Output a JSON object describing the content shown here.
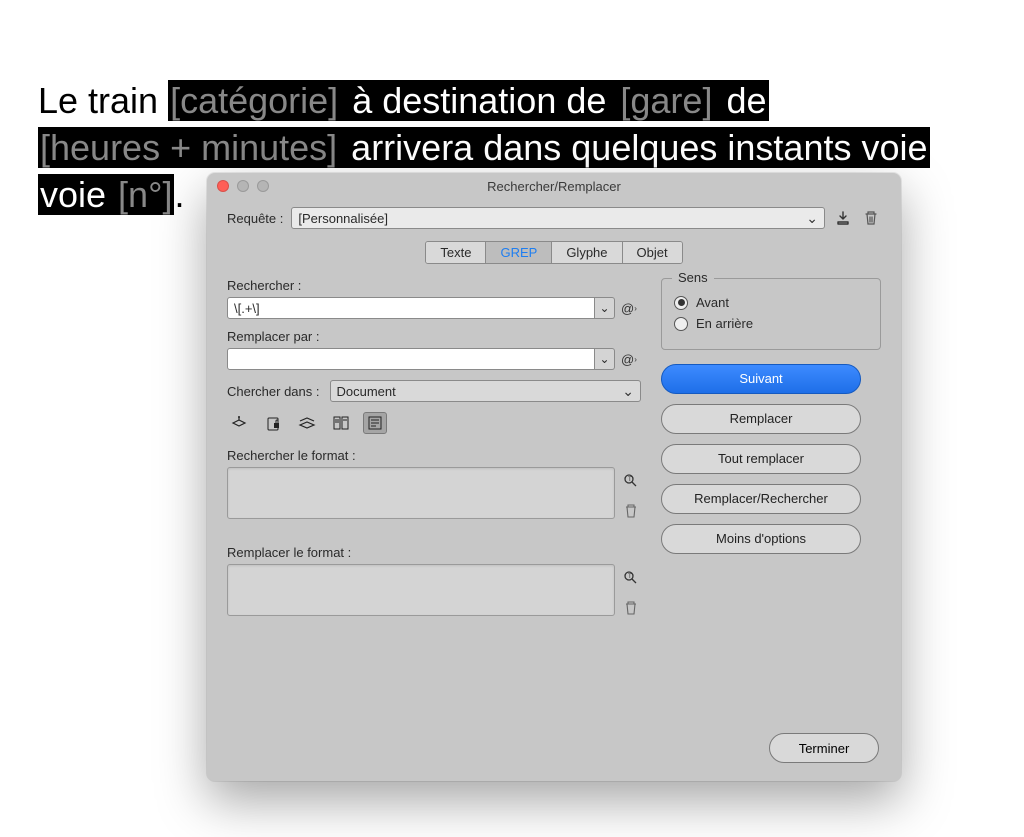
{
  "sentence": {
    "p1": "Le train ",
    "ph1": "[catégorie]",
    "p2": " à destination de ",
    "ph2": "[gare]",
    "p3": " de ",
    "ph3": "[heures + minutes]",
    "p4": " arrivera dans quelques instants voie ",
    "ph4": "[n°]",
    "p5": "."
  },
  "dialog": {
    "title": "Rechercher/Remplacer",
    "query_label": "Requête :",
    "query_value": "[Personnalisée]",
    "tabs": {
      "text": "Texte",
      "grep": "GREP",
      "glyph": "Glyphe",
      "object": "Objet"
    },
    "find_label": "Rechercher :",
    "find_value": "\\[.+\\]",
    "replace_label": "Remplacer par :",
    "replace_value": "",
    "search_in_label": "Chercher dans :",
    "search_in_value": "Document",
    "find_format_label": "Rechercher le format :",
    "replace_format_label": "Remplacer le format :",
    "direction": {
      "legend": "Sens",
      "forward": "Avant",
      "backward": "En arrière"
    },
    "buttons": {
      "next": "Suivant",
      "replace": "Remplacer",
      "replace_all": "Tout remplacer",
      "replace_find": "Remplacer/Rechercher",
      "less_options": "Moins d'options",
      "done": "Terminer"
    }
  }
}
